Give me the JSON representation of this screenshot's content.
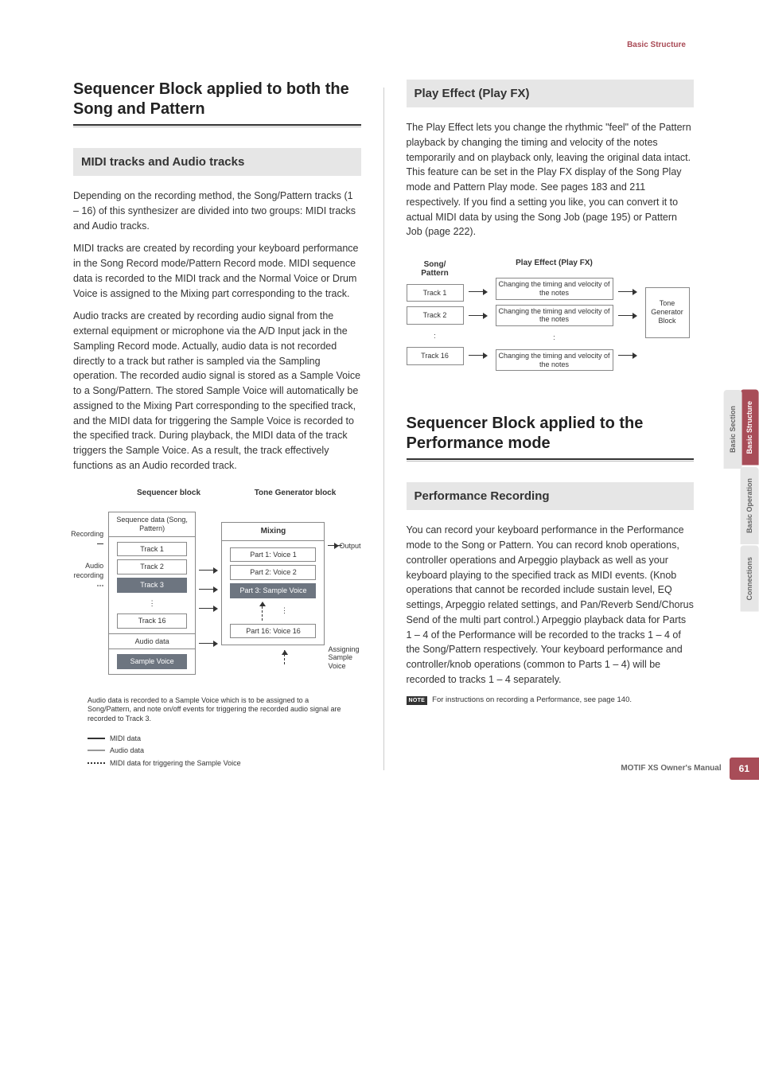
{
  "headerRight": "Basic Structure",
  "left": {
    "h2": "Sequencer Block applied to both the Song and Pattern",
    "h3": "MIDI tracks and Audio tracks",
    "p1": "Depending on the recording method, the Song/Pattern tracks (1 – 16) of this synthesizer are divided into two groups: MIDI tracks and Audio tracks.",
    "p2": "MIDI tracks are created by recording your keyboard performance in the Song Record mode/Pattern Record mode. MIDI sequence data is recorded to the MIDI track and the Normal Voice or Drum Voice is assigned to the Mixing part corresponding to the track.",
    "p3": "Audio tracks are created by recording audio signal from the external equipment or microphone via the A/D Input jack in the Sampling Record mode. Actually, audio data is not recorded directly to a track but rather is sampled via the Sampling operation. The recorded audio signal is stored as a Sample Voice to a Song/Pattern. The stored Sample Voice will automatically be assigned to the Mixing Part corresponding to the specified track, and the MIDI data for triggering the Sample Voice is recorded to the specified track. During playback, the MIDI data of the track triggers the Sample Voice. As a result, the track effectively functions as an Audio recorded track.",
    "dg1": {
      "seqHeader": "Sequencer block",
      "tgHeader": "Tone Generator block",
      "seqTitle": "Sequence data (Song, Pattern)",
      "recording": "Recording",
      "audioRecording": "Audio recording",
      "tracks": [
        "Track 1",
        "Track 2",
        "Track 3"
      ],
      "track16": "Track 16",
      "audioData": "Audio data",
      "sampleVoice": "Sample Voice",
      "mixing": "Mixing",
      "parts": [
        "Part 1: Voice 1",
        "Part 2: Voice 2",
        "Part 3: Sample Voice"
      ],
      "part16": "Part 16: Voice 16",
      "assigning": "Assigning Sample Voice",
      "output": "Output",
      "caption": "Audio data is recorded to a Sample Voice which is to be assigned to a Song/Pattern, and note on/off events for triggering the recorded audio signal are recorded to Track 3.",
      "legend": {
        "midi": "MIDI data",
        "audio": "Audio data",
        "trigger": "MIDI data for triggering the Sample Voice"
      }
    }
  },
  "right": {
    "h3a": "Play Effect (Play FX)",
    "p1": "The Play Effect lets you change the rhythmic \"feel\" of the Pattern playback by changing the timing and velocity of the notes temporarily and on playback only, leaving the original data intact. This feature can be set in the Play FX display of the Song Play mode and Pattern Play mode. See pages 183 and 211 respectively. If you find a setting you like, you can convert it to actual MIDI data by using the Song Job (page 195) or Pattern Job (page 222).",
    "dg2": {
      "leftLabel": "Song/\nPattern",
      "midLabel": "Play Effect (Play FX)",
      "tracks": [
        "Track 1",
        "Track 2",
        ":",
        "Track 16"
      ],
      "midBoxes": [
        "Changing the timing and velocity of the notes",
        "Changing the timing and velocity of the notes",
        ":",
        "Changing the timing and velocity of the notes"
      ],
      "rightBox": "Tone Generator Block"
    },
    "h2b": "Sequencer Block applied to the Performance mode",
    "h3b": "Performance Recording",
    "p2": "You can record your keyboard performance in the Performance mode to the Song or Pattern. You can record knob operations, controller operations and Arpeggio playback as well as your keyboard playing to the specified track as MIDI events. (Knob operations that cannot be recorded include sustain level, EQ settings, Arpeggio related settings, and Pan/Reverb Send/Chorus Send of the multi part control.) Arpeggio playback data for Parts 1 – 4 of the Performance will be recorded to the tracks 1 – 4 of the Song/Pattern respectively. Your keyboard performance and controller/knob operations (common to Parts 1 – 4) will be recorded to tracks 1 – 4 separately.",
    "noteBadge": "NOTE",
    "noteText": "For instructions on recording a Performance, see page 140."
  },
  "sideTabs": {
    "main": [
      "Basic Structure",
      "Basic Operation",
      "Connections"
    ],
    "sub": "Basic Section"
  },
  "footer": {
    "text": "MOTIF XS Owner's Manual",
    "page": "61"
  }
}
